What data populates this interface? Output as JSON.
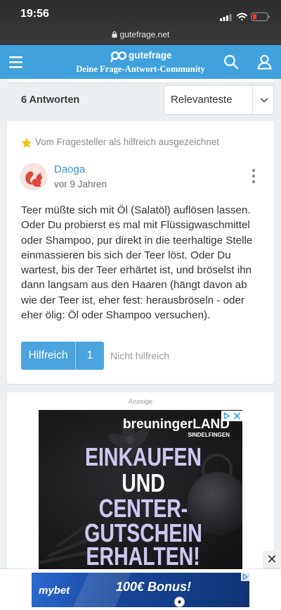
{
  "status_bar": {
    "time": "19:56",
    "battery_level": "low"
  },
  "browser": {
    "url": "gutefrage.net"
  },
  "header": {
    "brand": "gutefrage",
    "tagline": "Deine Frage-Antwort-Community",
    "icons": {
      "menu": "hamburger-icon",
      "logo": "gutefrage-logo-icon",
      "search": "search-icon",
      "account": "user-icon"
    }
  },
  "answers_bar": {
    "count_label": "6 Antworten",
    "sort": {
      "selected": "Relevanteste",
      "icon": "chevron-down-icon"
    }
  },
  "answer": {
    "badge": "Vom Fragesteller als hilfreich ausgezeichnet",
    "badge_icon": "star-icon",
    "author": "Daoga",
    "time": "vor 9 Jahren",
    "text_lines": [
      "Teer müßte sich mit Öl (Salatöl) auflösen lassen.",
      "Oder Du probierst es mal mit Flüssigwaschmittel",
      "oder Shampoo, pur direkt in die teerhaltige Stelle",
      "einmassieren bis sich der Teer löst. Oder Du",
      "wartest, bis der Teer erhärtet ist, und bröselst ihn",
      "dann langsam aus den Haaren (hängt davon ab",
      "wie der Teer ist, eher fest: herausbröseln - oder",
      "eher ölig: Öl oder Shampoo versuchen)."
    ],
    "helpful_label": "Hilfreich",
    "helpful_count": 1,
    "not_helpful_label": "Nicht hilfreich"
  },
  "ad": {
    "label": "Anzeige",
    "creative": {
      "brand_main": "breuninger",
      "brand_suffix": "LAND",
      "brand_location": "SINDELFINGEN",
      "headline": [
        "EINKAUFEN",
        "UND",
        "CENTER-",
        "GUTSCHEIN",
        "ERHALTEN!"
      ]
    }
  },
  "sticky_ad": {
    "close_symbol": "✕",
    "brand": "mybet",
    "headline": "100€ Bonus!"
  },
  "colors": {
    "chrome_bg": "#323232",
    "header_bg": "#40a1dd",
    "accent": "#3a8fd1",
    "helpful_button": "#4ba4dd",
    "star": "#f4c20d",
    "battery_low": "#ff3b30",
    "ad_headline": "#cdc8ee",
    "page_bg": "#edf0f2"
  }
}
